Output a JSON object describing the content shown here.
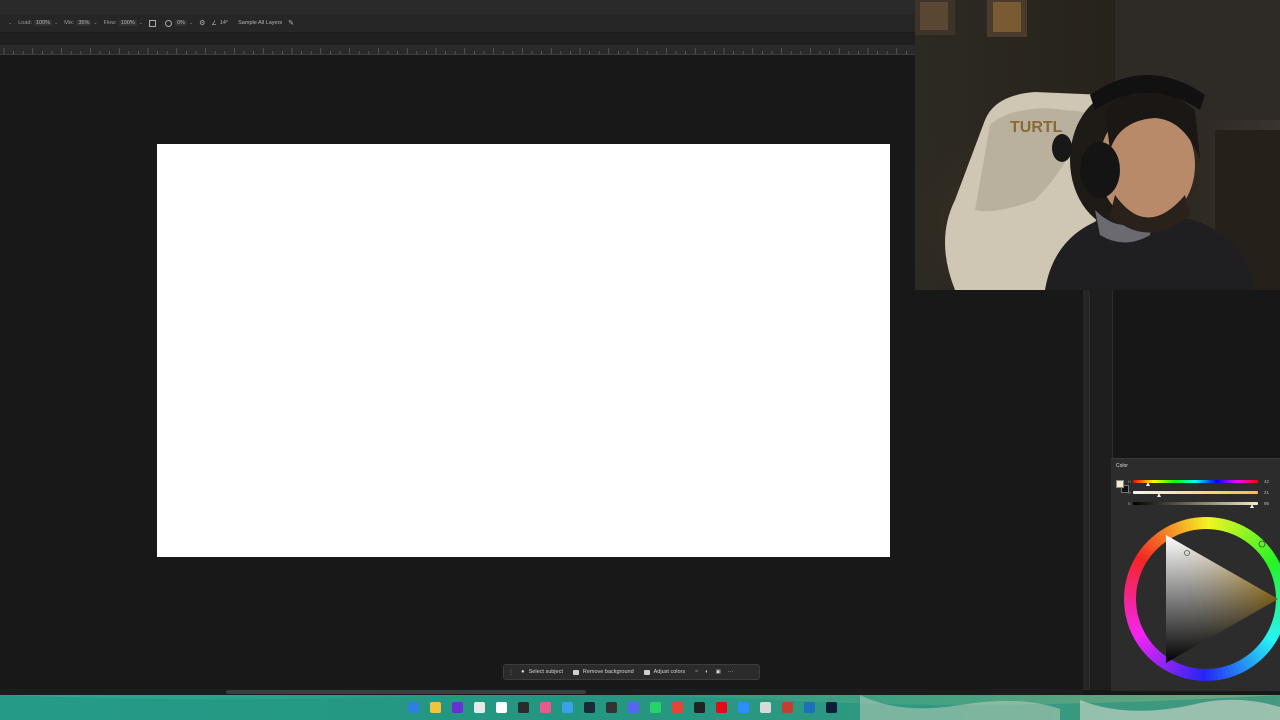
{
  "options_bar": {
    "load_label": "Load:",
    "load_value": "100%",
    "mix_label": "Mix:",
    "mix_value": "35%",
    "flow_label": "Flow:",
    "flow_value": "100%",
    "smooth_value": "0%",
    "angle_value": "14°",
    "sample_all_layers": "Sample All Layers"
  },
  "context_taskbar": {
    "select_subject": "Select subject",
    "remove_background": "Remove background",
    "adjust_colors": "Adjust colors",
    "more": "···"
  },
  "color_panel": {
    "title": "Color",
    "sliders": [
      {
        "label": "H",
        "value": "42",
        "level": 0.12
      },
      {
        "label": "S",
        "value": "21",
        "level": 0.21
      },
      {
        "label": "B",
        "value": "95",
        "level": 0.95
      }
    ],
    "foreground_color": "#f3ecc6",
    "background_color": "#111111"
  },
  "webcam": {
    "chair_text": "TURTL"
  },
  "colors": {
    "canvas": "#ffffff",
    "workspace": "#181818"
  },
  "taskbar_icons": [
    "windows-icon",
    "file-explorer-icon",
    "nzxt-icon",
    "app-icon",
    "xbox-icon",
    "obs-icon",
    "browser-icon",
    "twitter-icon",
    "steam-icon",
    "dots-icon",
    "discord-icon",
    "whatsapp-icon",
    "chrome-icon",
    "media-icon",
    "netflix-icon",
    "zoom-icon",
    "app2-icon",
    "app3-icon",
    "app4-icon",
    "photoshop-icon"
  ]
}
